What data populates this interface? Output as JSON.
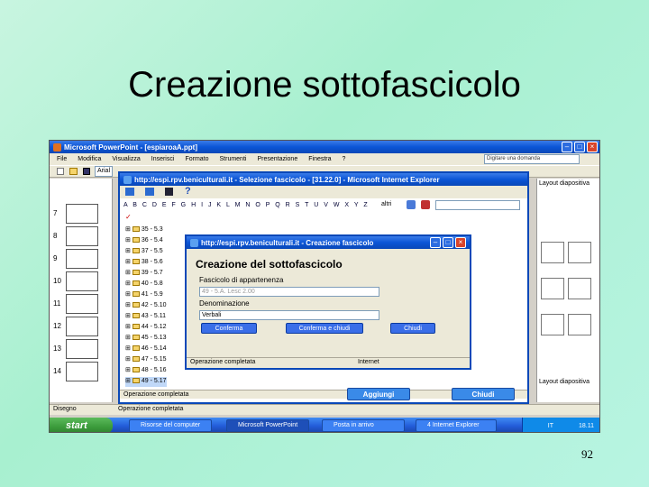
{
  "slide": {
    "title": "Creazione sottofascicolo",
    "number": "92"
  },
  "powerpoint": {
    "title": "Microsoft PowerPoint - [espiaroaA.ppt]",
    "menu": [
      "File",
      "Modifica",
      "Visualizza",
      "Inserisci",
      "Formato",
      "Strumenti",
      "Presentazione",
      "Finestra",
      "?"
    ],
    "help_placeholder": "Digitare una domanda",
    "font_box": "Arial",
    "slide_numbers": [
      "7",
      "8",
      "9",
      "10",
      "11",
      "12",
      "13",
      "14"
    ],
    "right_pane_title": "Layout diapositiva",
    "right_pane_bottom": "Layout diapositiva",
    "drawbar_label": "Disegno",
    "status": "Operazione completata"
  },
  "ie_back": {
    "title": "http://espi.rpv.beniculturali.it - Selezione fascicolo - [31.22.0] - Microsoft Internet Explorer",
    "alphabet": "A B C D E F G H I J K L M N O P Q R S T U V W X Y Z",
    "search_label": "altri",
    "tree_rows": [
      "35 - 5.3",
      "36 - 5.4",
      "37 - 5.5",
      "38 - 5.6",
      "39 - 5.7",
      "40 - 5.8",
      "41 - 5.9",
      "42 - 5.10",
      "43 - 5.11",
      "44 - 5.12",
      "45 - 5.13",
      "46 - 5.14",
      "47 - 5.15",
      "48 - 5.16",
      "49 - 5.17"
    ],
    "btn_add": "Aggiungi",
    "btn_close": "Chiudi",
    "status": "Operazione completata"
  },
  "ie_front": {
    "title": "http://espi.rpv.beniculturali.it - Creazione fascicolo",
    "heading": "Creazione del sottofascicolo",
    "field1_label": "Fascicolo di appartenenza",
    "field1_value": "49 - 5.A. Lesc 2.00",
    "field2_label": "Denominazione",
    "field2_value": "Verbali",
    "btn_confirm": "Conferma",
    "btn_confirm_close": "Conferma e chiudi",
    "btn_close": "Chiudi",
    "status": "Operazione completata",
    "zone": "Internet"
  },
  "taskbar": {
    "start": "start",
    "tasks": [
      "Risorse del computer",
      "Microsoft PowerPoint",
      "Posta in arrivo",
      "4 Internet Explorer"
    ],
    "lang": "IT",
    "clock": "18.11"
  }
}
